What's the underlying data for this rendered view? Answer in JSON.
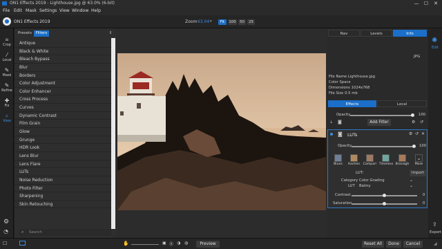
{
  "window": {
    "title": "ON1 Effects 2019 - Lighthouse.jpg @ 63.0% (6-bit)",
    "minimize": "—",
    "maximize": "☐",
    "close": "✕"
  },
  "menu": [
    "File",
    "Edit",
    "Mask",
    "Settings",
    "View",
    "Window",
    "Help"
  ],
  "toolbar": {
    "app_name": "ON1 Effects 2019",
    "zoom_label": "Zoom",
    "zoom_value": "63.04",
    "fit": "Fit",
    "z100": "100",
    "z50": "50",
    "z25": "25"
  },
  "left_tools": [
    {
      "label": "Crop",
      "icon": "⌗"
    },
    {
      "label": "Local",
      "icon": "⁄"
    },
    {
      "label": "Mask",
      "icon": "✎"
    },
    {
      "label": "Refine",
      "icon": "✎"
    },
    {
      "label": "Fix",
      "icon": "✚"
    },
    {
      "label": "View",
      "icon": "⌕"
    }
  ],
  "filter_panel": {
    "tab_presets": "Presets",
    "tab_filters": "Filters",
    "search_placeholder": "Search",
    "items": [
      "Antique",
      "Black & White",
      "Bleach Bypass",
      "Blur",
      "Borders",
      "Color Adjustment",
      "Color Enhancer",
      "Cross Process",
      "Curves",
      "Dynamic Contrast",
      "Film Grain",
      "Glow",
      "Grunge",
      "HDR Look",
      "Lens Blur",
      "Lens Flare",
      "LUTs",
      "Noise Reduction",
      "Photo Filter",
      "Sharpening",
      "Skin Retouching"
    ]
  },
  "right_panel": {
    "tabs": [
      "Nav",
      "Levels",
      "Info"
    ],
    "format": "JPG",
    "file_info": [
      {
        "label": "File Name",
        "value": "Lighthouse.jpg"
      },
      {
        "label": "Color Space",
        "value": ""
      },
      {
        "label": "Dimensions",
        "value": "1024x768"
      },
      {
        "label": "File Size",
        "value": "0.5 mb"
      }
    ],
    "section_tabs": [
      "Effects",
      "Local"
    ],
    "opacity_label": "Opacity",
    "opacity_value": "100",
    "opacity_level": 1.0,
    "add_filter": "Add Filter",
    "lut": {
      "title": "LUTs",
      "opacity_label": "Opacity",
      "opacity_value": "100",
      "opacity_level": 1.0,
      "swatches": [
        {
          "name": "Blues",
          "color": "#6f7f96"
        },
        {
          "name": "Aachen",
          "color": "#b08a5e"
        },
        {
          "name": "Campari",
          "color": "#9c7a62"
        },
        {
          "name": "Timeless",
          "color": "#6fa59e"
        },
        {
          "name": "Branagh",
          "color": "#a67a5b"
        },
        {
          "name": "More",
          "color": "#3a3a3a"
        }
      ],
      "lut_label": "LUT:",
      "import": "Import",
      "category_label": "Category",
      "category_value": "Color Grading",
      "lut_name_label": "LUT",
      "lut_name_value": "Balmy",
      "contrast_label": "Contrast",
      "contrast_value": "0",
      "contrast_level": 0.5,
      "saturation_label": "Saturation",
      "saturation_value": "0",
      "saturation_level": 0.5
    }
  },
  "far_right": {
    "edit": "Edit",
    "export": "Export"
  },
  "bottom": {
    "preview": "Preview",
    "reset_all": "Reset All",
    "done": "Done",
    "cancel": "Cancel"
  },
  "colors": {
    "accent": "#1b6fc9",
    "panel": "#2e2e2e",
    "canvas": "#2c2c2c"
  }
}
